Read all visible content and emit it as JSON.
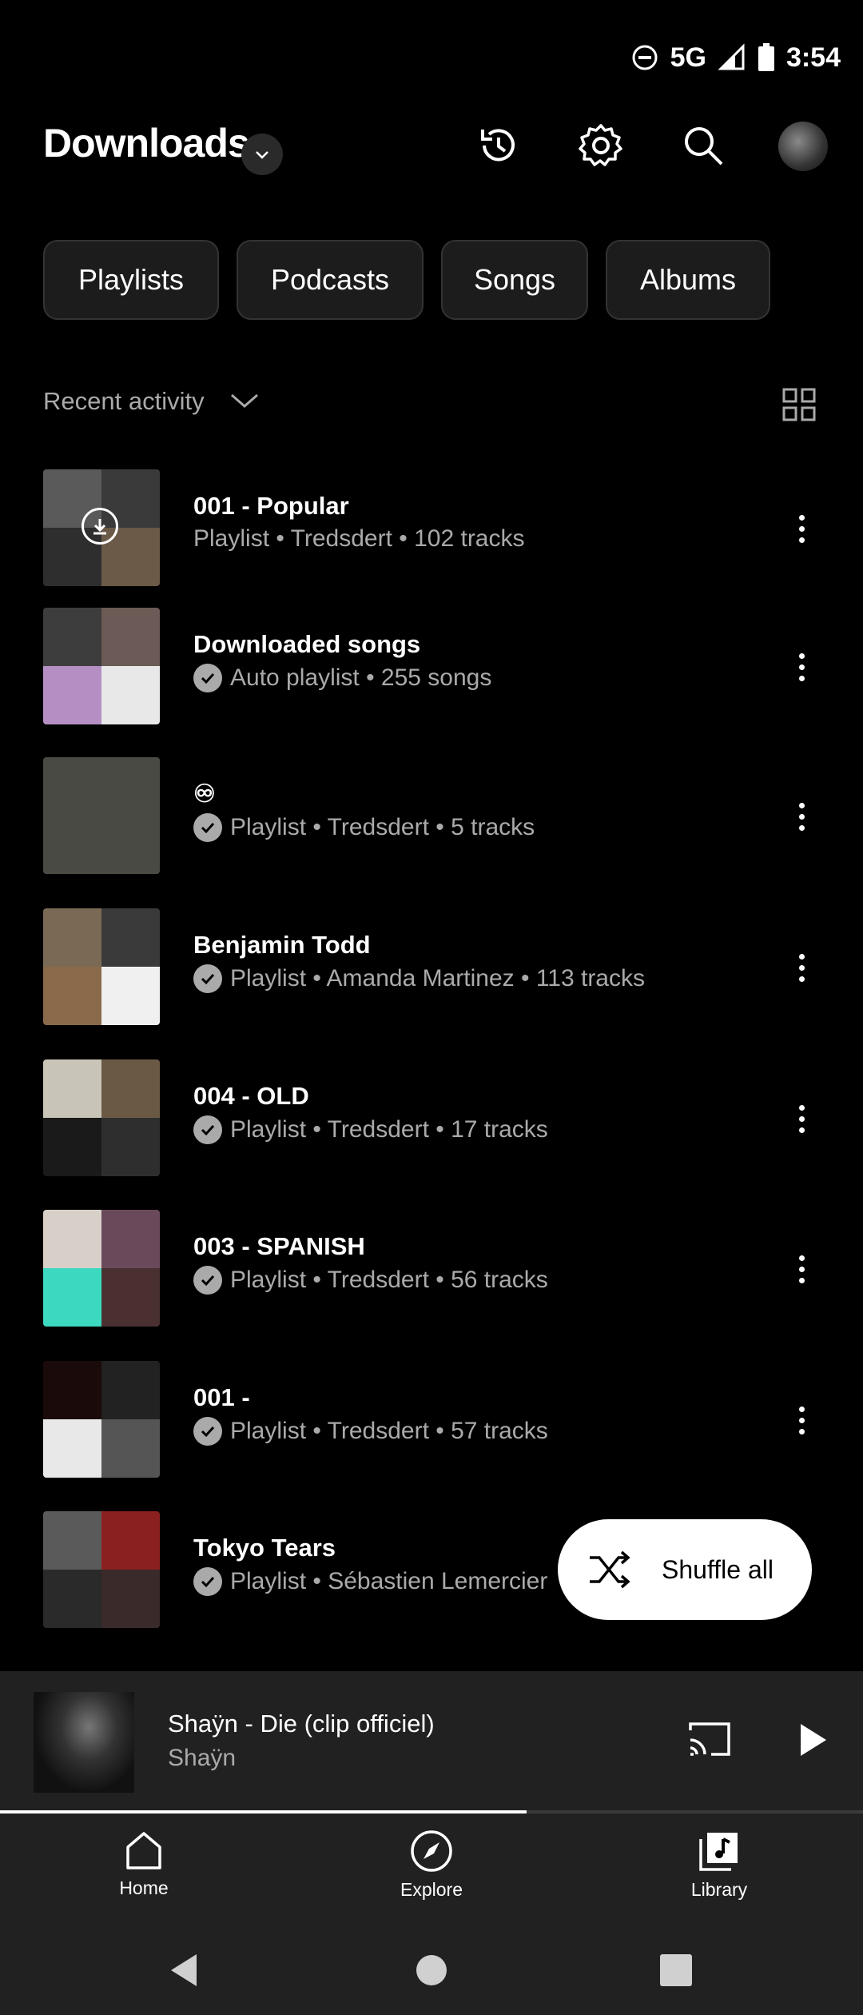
{
  "status": {
    "network": "5G",
    "time": "3:54"
  },
  "header": {
    "title": "Downloads"
  },
  "chips": [
    "Playlists",
    "Podcasts",
    "Songs",
    "Albums"
  ],
  "sort": {
    "label": "Recent activity"
  },
  "items": [
    {
      "title": "001 - Popular",
      "subtitle": "Playlist • Tredsdert • 102 tracks",
      "downloaded": false,
      "colors": [
        "#5a5a5a",
        "#3a3a3a",
        "#2e2e2e",
        "#6b5a48"
      ]
    },
    {
      "title": "Downloaded songs",
      "subtitle": "Auto playlist • 255 songs",
      "downloaded": true,
      "colors": [
        "#3d3d3d",
        "#6b5a55",
        "#b58fc4",
        "#e8e8e8"
      ]
    },
    {
      "title": "♾",
      "subtitle": "Playlist • Tredsdert • 5 tracks",
      "downloaded": true,
      "colors": [
        "#4a4a44",
        "#4a4a44",
        "#4a4a44",
        "#4a4a44"
      ]
    },
    {
      "title": "Benjamin Todd",
      "subtitle": "Playlist • Amanda Martinez • 113 tracks",
      "downloaded": true,
      "colors": [
        "#7a6a55",
        "#3a3a3a",
        "#8a6a4a",
        "#f0f0f0"
      ]
    },
    {
      "title": "004 - OLD",
      "subtitle": "Playlist • Tredsdert • 17 tracks",
      "downloaded": true,
      "colors": [
        "#c8c4b8",
        "#6a5a45",
        "#1a1a1a",
        "#2e2e2e"
      ]
    },
    {
      "title": "003 - SPANISH",
      "subtitle": "Playlist • Tredsdert • 56 tracks",
      "downloaded": true,
      "colors": [
        "#d8d0c8",
        "#6a4a5a",
        "#3dd8c0",
        "#4a3030"
      ]
    },
    {
      "title": "001 -",
      "subtitle": "Playlist • Tredsdert • 57 tracks",
      "downloaded": true,
      "colors": [
        "#1a0a0a",
        "#222",
        "#e8e8e8",
        "#555"
      ]
    },
    {
      "title": "Tokyo Tears",
      "subtitle": "Playlist • Sébastien Lemercier",
      "downloaded": true,
      "colors": [
        "#5a5a5a",
        "#8a2020",
        "#2a2a2a",
        "#3a2a2a"
      ]
    }
  ],
  "shuffle": {
    "label": "Shuffle all"
  },
  "player": {
    "title": "Shaÿn - Die (clip officiel)",
    "artist": "Shaÿn",
    "progress": 0.61
  },
  "nav": [
    "Home",
    "Explore",
    "Library"
  ]
}
